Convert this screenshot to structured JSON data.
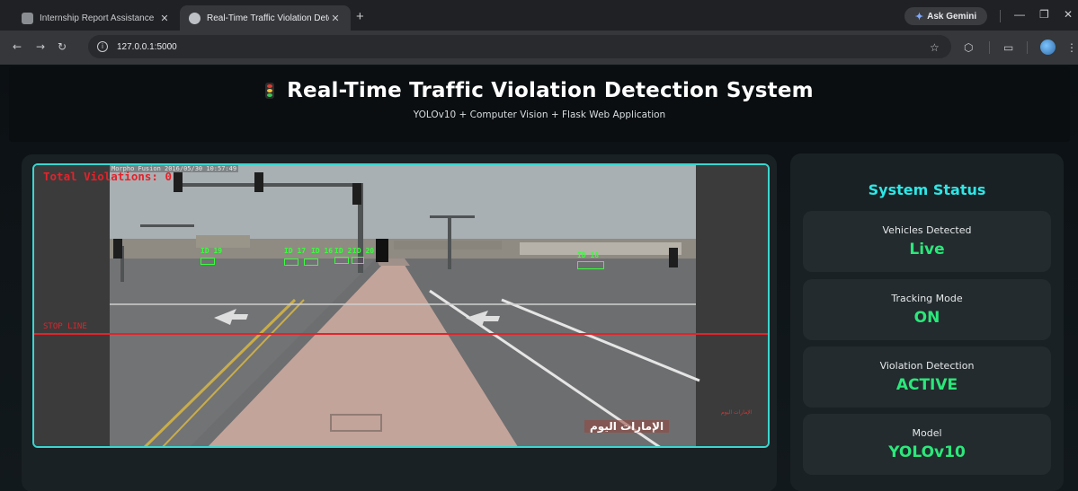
{
  "browser": {
    "tabs": [
      {
        "title": "Internship Report Assistance",
        "active": false,
        "favicon": "chat-icon"
      },
      {
        "title": "Real-Time Traffic Violation Dete",
        "active": true,
        "favicon": "globe-icon"
      }
    ],
    "new_tab": "+",
    "gemini_label": "Ask Gemini",
    "url": "127.0.0.1:5000"
  },
  "header": {
    "title": "Real-Time Traffic Violation Detection System",
    "subtitle": "YOLOv10 + Computer Vision + Flask Web Application",
    "icon": "traffic-light-icon"
  },
  "video": {
    "total_violations_label": "Total Violations: 0",
    "stop_line_label": "STOP LINE",
    "timestamp": "Morpho Fusion 2016/05/30 10:57:49",
    "watermark": "الإمارات اليوم",
    "watermark_small": "الإمارات اليوم",
    "detections": [
      {
        "label": "ID 19"
      },
      {
        "label": "ID 17"
      },
      {
        "label": "ID 16"
      },
      {
        "label": "ID 2"
      },
      {
        "label": "ID 20"
      },
      {
        "label": "ID 18"
      }
    ]
  },
  "status": {
    "heading": "System Status",
    "cards": [
      {
        "label": "Vehicles Detected",
        "value": "Live"
      },
      {
        "label": "Tracking Mode",
        "value": "ON"
      },
      {
        "label": "Violation Detection",
        "value": "ACTIVE"
      },
      {
        "label": "Model",
        "value": "YOLOv10"
      }
    ]
  },
  "colors": {
    "accent_cyan": "#2ee6e6",
    "status_green": "#2be87a",
    "violation_red": "#e4222a",
    "detection_green": "#37ff3a"
  }
}
